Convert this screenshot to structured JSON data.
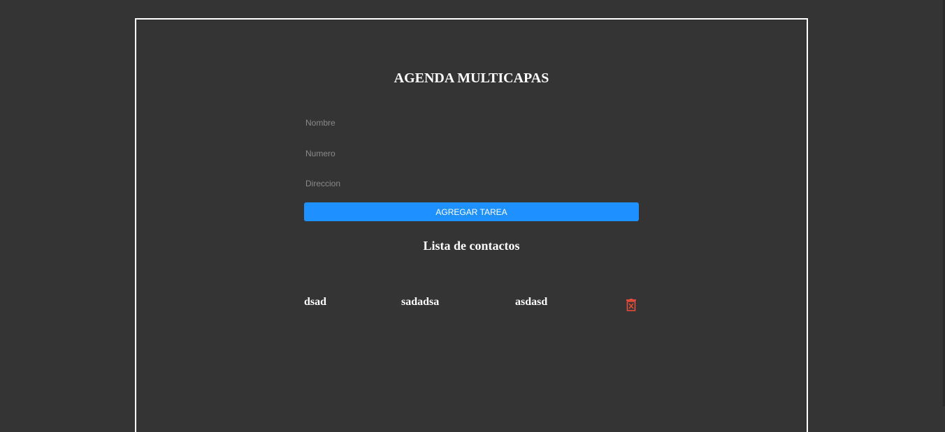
{
  "app": {
    "title": "AGENDA MULTICAPAS"
  },
  "form": {
    "nombre": {
      "value": "",
      "placeholder": "Nombre"
    },
    "numero": {
      "value": "",
      "placeholder": "Numero"
    },
    "direccion": {
      "value": "",
      "placeholder": "Direccion"
    },
    "submit_label": "AGREGAR TAREA"
  },
  "contacts": {
    "heading": "Lista de contactos",
    "items": [
      {
        "nombre": "dsad",
        "numero": "sadadsa",
        "direccion": "asdasd",
        "action_icon": "trash-icon"
      }
    ]
  },
  "colors": {
    "background": "#343434",
    "frame_border": "#ffffff",
    "accent": "#1e90ff",
    "delete": "#e74c3c"
  }
}
